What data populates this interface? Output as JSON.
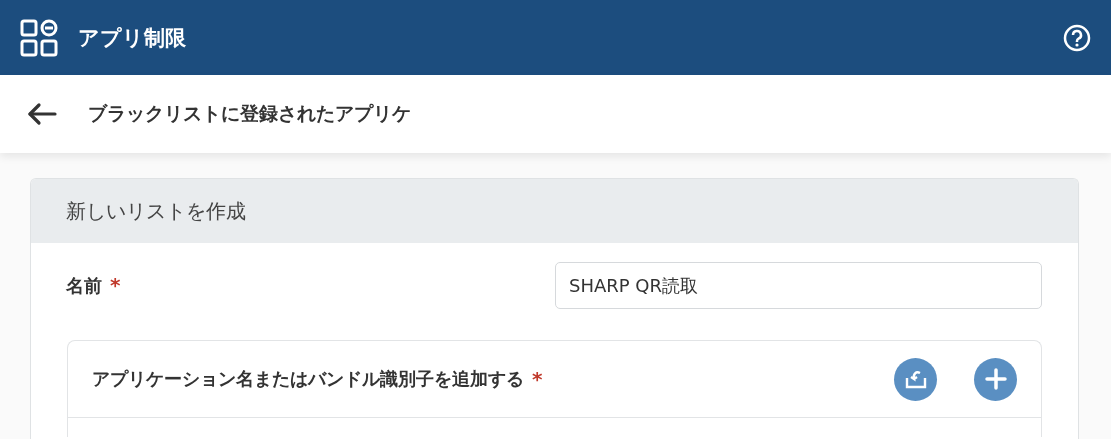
{
  "app_bar": {
    "title": "アプリ制限"
  },
  "sub_header": {
    "title": "ブラックリストに登録されたアプリケ"
  },
  "card": {
    "title": "新しいリストを作成",
    "name_field": {
      "label": "名前",
      "required_mark": "*",
      "value": "SHARP QR読取"
    },
    "apps_section": {
      "title": "アプリケーション名またはバンドル識別子を追加する",
      "required_mark": "*"
    }
  }
}
